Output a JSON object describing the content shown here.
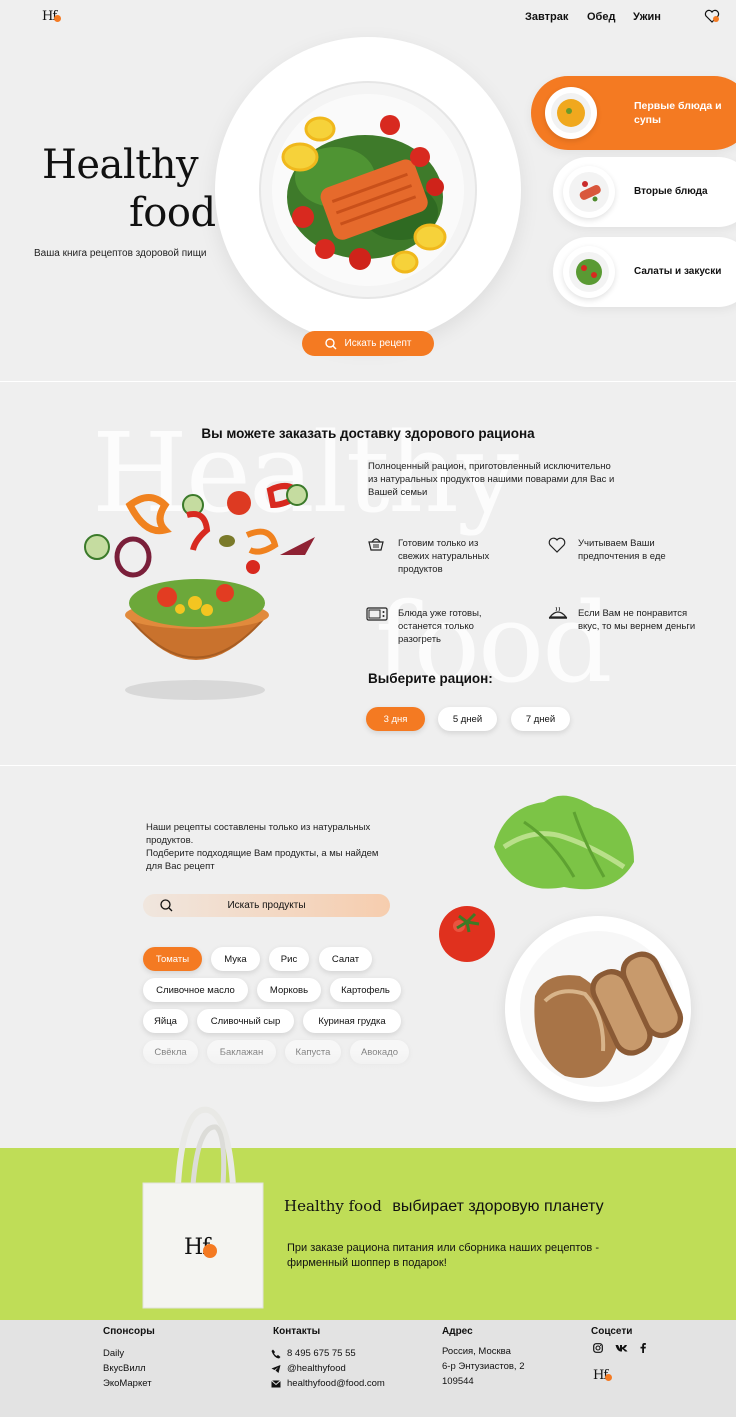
{
  "header": {
    "logo": "Hf",
    "nav": [
      "Завтрак",
      "Обед",
      "Ужин"
    ]
  },
  "hero": {
    "title_line1": "Healthy",
    "title_line2": "food",
    "subtitle": "Ваша книга рецептов здоровой пищи",
    "search_button": "Искать рецепт"
  },
  "categories": [
    {
      "label": "Первые блюда и супы",
      "active": true
    },
    {
      "label": "Вторые блюда",
      "active": false
    },
    {
      "label": "Салаты и закуски",
      "active": false
    }
  ],
  "delivery": {
    "title": "Вы можете заказать доставку здорового рациона",
    "bg_word1": "Healthy",
    "bg_word2": "food",
    "intro": "Полноценный рацион, приготовленный исключительно из натуральных продуктов нашими поварами для Вас и Вашей семьи",
    "features": [
      {
        "icon": "basket-icon",
        "text": "Готовим только из свежих натуральных продуктов"
      },
      {
        "icon": "heart-icon",
        "text": "Учитываем Ваши предпочтения в еде"
      },
      {
        "icon": "microwave-icon",
        "text": "Блюда  уже готовы, останется только разогреть"
      },
      {
        "icon": "dish-icon",
        "text": "Если Вам не понравится вкус, то мы вернем деньги"
      }
    ],
    "choose_title": "Выберите рацион:",
    "options": [
      {
        "label": "3 дня",
        "active": true
      },
      {
        "label": "5 дней",
        "active": false
      },
      {
        "label": "7 дней",
        "active": false
      }
    ]
  },
  "products": {
    "intro": "Наши рецепты составлены только из натуральных продуктов.\nПодберите подходящие Вам продукты, а мы найдем для Вас рецепт",
    "search_label": "Искать продукты",
    "rows": [
      [
        {
          "label": "Томаты",
          "active": true
        },
        {
          "label": "Мука"
        },
        {
          "label": "Рис"
        },
        {
          "label": "Салат"
        }
      ],
      [
        {
          "label": "Сливочное масло"
        },
        {
          "label": "Морковь"
        },
        {
          "label": "Картофель"
        }
      ],
      [
        {
          "label": "Яйца"
        },
        {
          "label": "Сливочный сыр"
        },
        {
          "label": "Куриная грудка"
        }
      ],
      [
        {
          "label": "Свёкла"
        },
        {
          "label": "Баклажан"
        },
        {
          "label": "Капуста"
        },
        {
          "label": "Авокадо"
        }
      ]
    ]
  },
  "promo": {
    "brand": "Healthy food",
    "tagline": "выбирает здоровую планету",
    "text": "При заказе рациона питания или сборника наших рецептов - фирменный шоппер в подарок!",
    "bag_logo": "Hf"
  },
  "footer": {
    "sponsors_title": "Спонсоры",
    "sponsors": [
      "Daily",
      "ВкусВилл",
      "ЭкоМаркет"
    ],
    "contacts_title": "Контакты",
    "phone": "8 495 675 75 55",
    "telegram": "@healthyfood",
    "email": "healthyfood@food.com",
    "address_title": "Адрес",
    "address_lines": [
      "Россия, Москва",
      "6-р Энтузиастов, 2",
      "109544"
    ],
    "social_title": "Соцсети",
    "logo": "Hf"
  },
  "colors": {
    "accent": "#f47a22",
    "promo_bg": "#bfdd57",
    "footer_bg": "#e3e3e3"
  }
}
